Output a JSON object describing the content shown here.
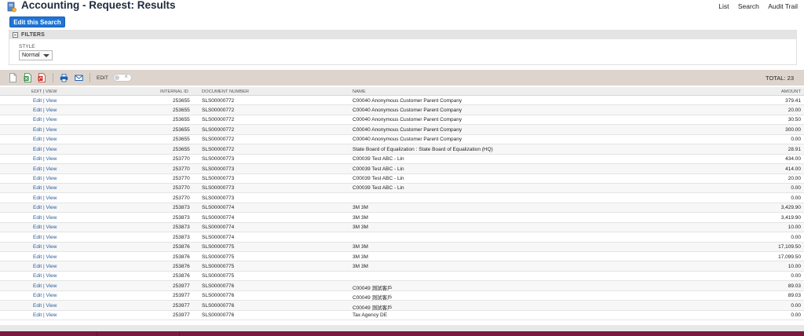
{
  "header": {
    "title": "Accounting - Request: Results",
    "links": [
      "List",
      "Search",
      "Audit Trail"
    ]
  },
  "edit_search_button": "Edit this Search",
  "filters": {
    "label": "FILTERS",
    "style_label": "STYLE",
    "style_value": "Normal"
  },
  "toolbar": {
    "edit_label": "EDIT",
    "total": "TOTAL: 23",
    "icons": [
      "new-document-icon",
      "excel-export-icon",
      "pdf-export-icon",
      "print-icon",
      "email-icon"
    ]
  },
  "table": {
    "columns": [
      "EDIT | VIEW",
      "INTERNAL ID",
      "DOCUMENT NUMBER",
      "NAME",
      "AMOUNT"
    ],
    "edit_text": "Edit",
    "view_text": "View",
    "rows": [
      {
        "id": "253655",
        "doc": "SLS00000772",
        "name": "C00040 Anonymous Customer Parent Company",
        "amount": "379.41"
      },
      {
        "id": "253655",
        "doc": "SLS00000772",
        "name": "C00040 Anonymous Customer Parent Company",
        "amount": "20.00"
      },
      {
        "id": "253655",
        "doc": "SLS00000772",
        "name": "C00040 Anonymous Customer Parent Company",
        "amount": "30.50"
      },
      {
        "id": "253655",
        "doc": "SLS00000772",
        "name": "C00040 Anonymous Customer Parent Company",
        "amount": "300.00"
      },
      {
        "id": "253655",
        "doc": "SLS00000772",
        "name": "C00040 Anonymous Customer Parent Company",
        "amount": "0.00"
      },
      {
        "id": "253655",
        "doc": "SLS00000772",
        "name": "State Board of Equalization : State Board of Equalization (HQ)",
        "amount": "28.91"
      },
      {
        "id": "253770",
        "doc": "SLS00000773",
        "name": "C00039 Test ABC - Lin",
        "amount": "434.00"
      },
      {
        "id": "253770",
        "doc": "SLS00000773",
        "name": "C00039 Test ABC - Lin",
        "amount": "414.00"
      },
      {
        "id": "253770",
        "doc": "SLS00000773",
        "name": "C00039 Test ABC - Lin",
        "amount": "20.00"
      },
      {
        "id": "253770",
        "doc": "SLS00000773",
        "name": "C00039 Test ABC - Lin",
        "amount": "0.00"
      },
      {
        "id": "253770",
        "doc": "SLS00000773",
        "name": "",
        "amount": "0.00"
      },
      {
        "id": "253873",
        "doc": "SLS00000774",
        "name": "3M 3M",
        "amount": "3,429.90"
      },
      {
        "id": "253873",
        "doc": "SLS00000774",
        "name": "3M 3M",
        "amount": "3,419.90"
      },
      {
        "id": "253873",
        "doc": "SLS00000774",
        "name": "3M 3M",
        "amount": "10.00"
      },
      {
        "id": "253873",
        "doc": "SLS00000774",
        "name": "",
        "amount": "0.00"
      },
      {
        "id": "253876",
        "doc": "SLS00000775",
        "name": "3M 3M",
        "amount": "17,109.50"
      },
      {
        "id": "253876",
        "doc": "SLS00000775",
        "name": "3M 3M",
        "amount": "17,099.50"
      },
      {
        "id": "253876",
        "doc": "SLS00000775",
        "name": "3M 3M",
        "amount": "10.00"
      },
      {
        "id": "253876",
        "doc": "SLS00000775",
        "name": "",
        "amount": "0.00"
      },
      {
        "id": "253977",
        "doc": "SLS00000776",
        "name": "C00049 測試客戶",
        "amount": "89.03"
      },
      {
        "id": "253977",
        "doc": "SLS00000776",
        "name": "C00049 測試客戶",
        "amount": "89.03"
      },
      {
        "id": "253977",
        "doc": "SLS00000776",
        "name": "C00049 測試客戶",
        "amount": "0.00"
      },
      {
        "id": "253977",
        "doc": "SLS00000776",
        "name": "Tax Agency DE",
        "amount": "0.00"
      }
    ]
  }
}
